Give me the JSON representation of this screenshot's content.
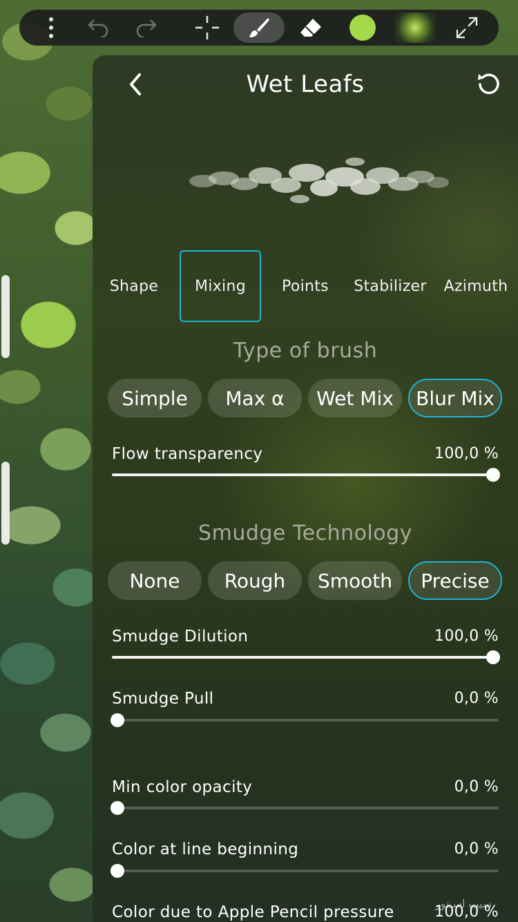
{
  "toolbar": {
    "items": [
      "more-menu",
      "undo",
      "redo",
      "transform",
      "brush",
      "eraser",
      "color",
      "brush-texture",
      "fullscreen"
    ],
    "active": "brush",
    "current_color": "#a3d94a"
  },
  "panel": {
    "title": "Wet Leafs",
    "tabs": [
      {
        "label": "Shape"
      },
      {
        "label": "Mixing"
      },
      {
        "label": "Points"
      },
      {
        "label": "Stabilizer"
      },
      {
        "label": "Azimuth"
      }
    ],
    "selected_tab": "Mixing",
    "brush_type": {
      "heading": "Type of brush",
      "options": [
        "Simple",
        "Max α",
        "Wet Mix",
        "Blur Mix"
      ],
      "selected": "Blur Mix"
    },
    "flow_transparency": {
      "label": "Flow transparency",
      "value_text": "100,0 %",
      "value": 100
    },
    "smudge": {
      "heading": "Smudge Technology",
      "options": [
        "None",
        "Rough",
        "Smooth",
        "Precise"
      ],
      "selected": "Precise"
    },
    "smudge_dilution": {
      "label": "Smudge Dilution",
      "value_text": "100,0 %",
      "value": 100
    },
    "smudge_pull": {
      "label": "Smudge Pull",
      "value_text": "0,0 %",
      "value": 0
    },
    "min_color_opacity": {
      "label": "Min color opacity",
      "value_text": "0,0 %",
      "value": 0
    },
    "color_line_beginning": {
      "label": "Color at line beginning",
      "value_text": "0,0 %",
      "value": 0
    },
    "color_pencil_pressure": {
      "label": "Color due to Apple Pencil pressure",
      "value_text": "100,0 %",
      "value": 100
    }
  },
  "watermark": "سيب اسـتور"
}
